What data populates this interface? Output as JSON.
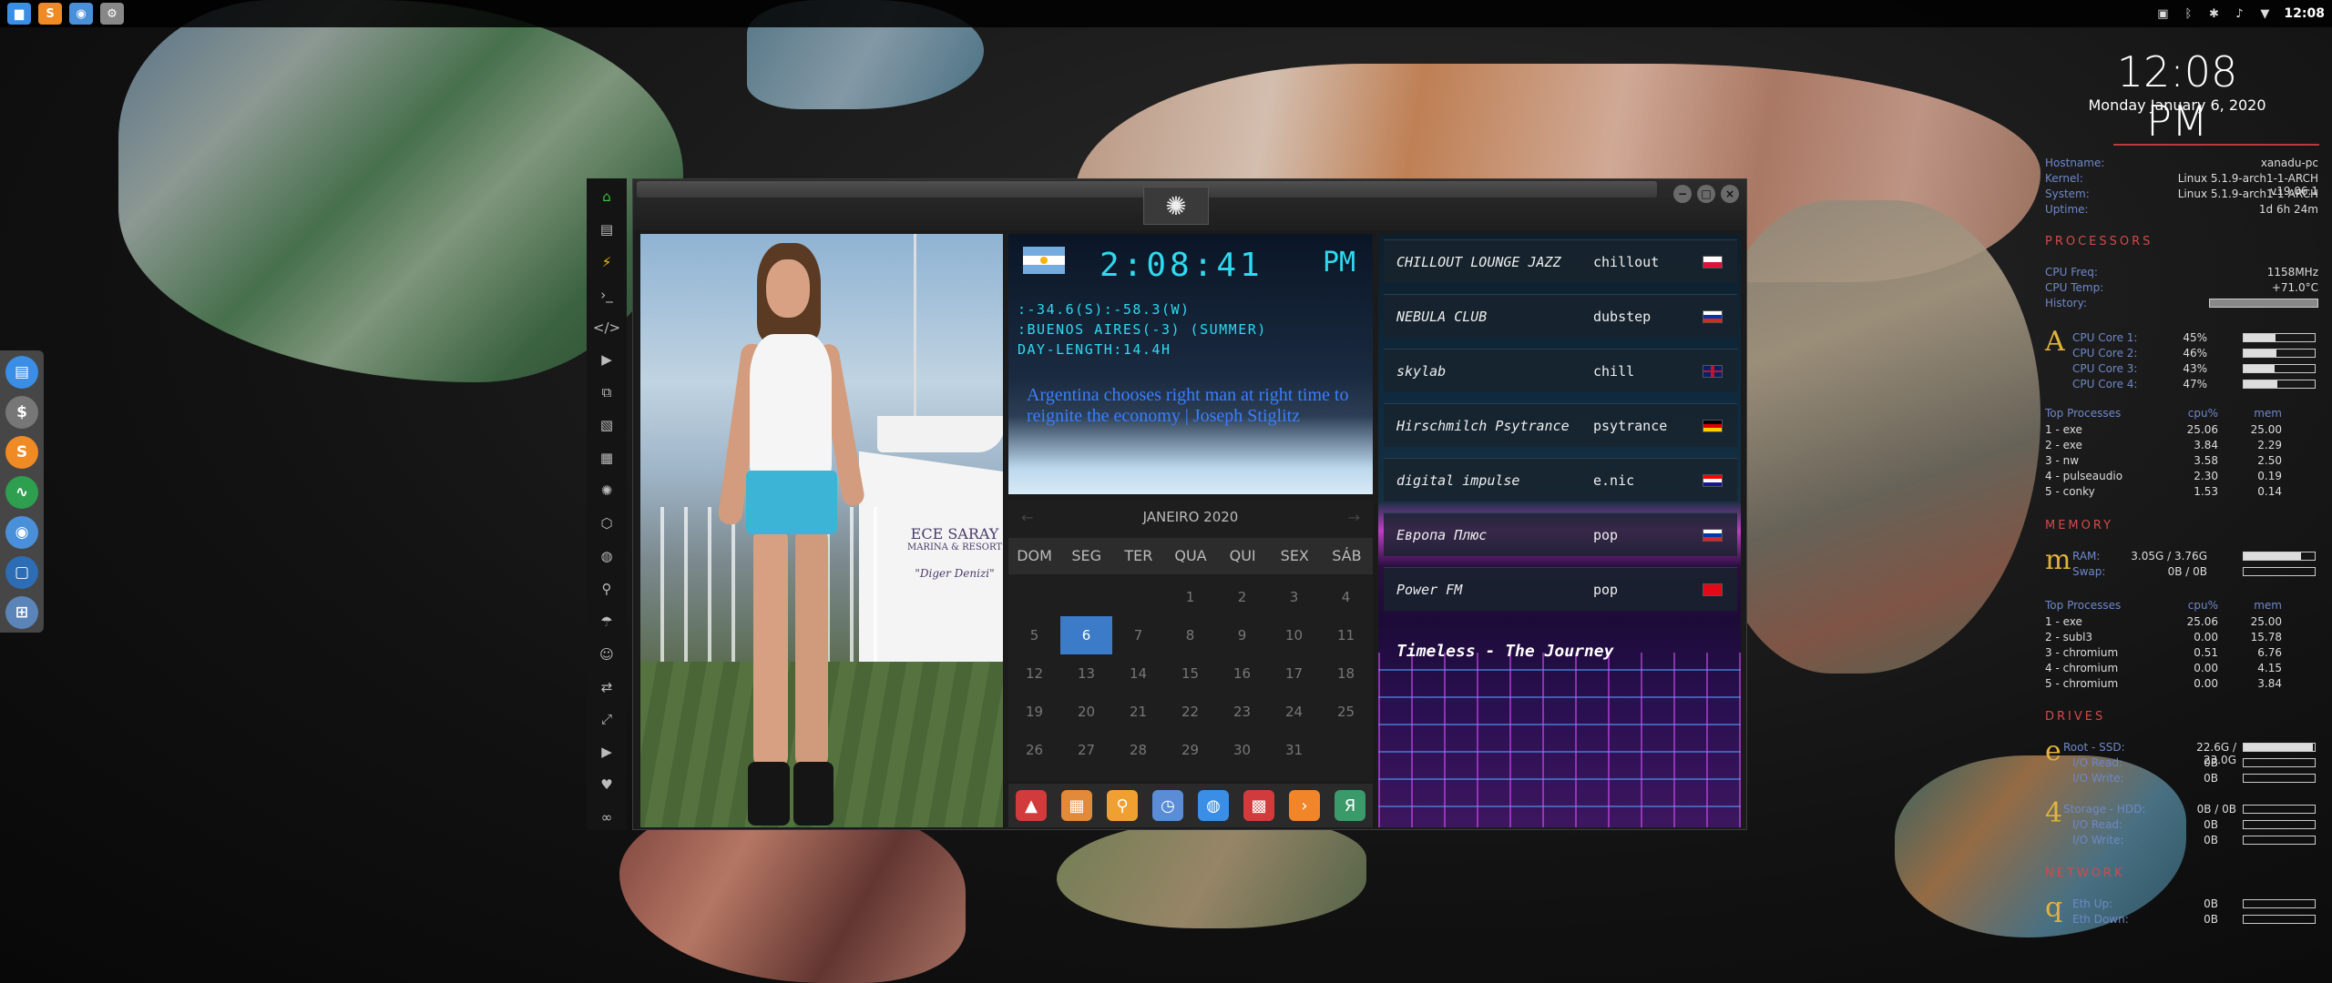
{
  "top_panel": {
    "launchers": [
      {
        "icon": "files-icon",
        "glyph": "▆",
        "color": "#3a8ee6"
      },
      {
        "icon": "sublime-icon",
        "glyph": "S",
        "color": "#f08a24"
      },
      {
        "icon": "chrome-icon",
        "glyph": "◉",
        "color": "#4a90d9"
      },
      {
        "icon": "settings-icon",
        "glyph": "⚙",
        "color": "#888888"
      }
    ],
    "tray": [
      {
        "icon": "screenshot-icon",
        "glyph": "▣"
      },
      {
        "icon": "bluetooth-icon",
        "glyph": "ᛒ"
      },
      {
        "icon": "security-alert-icon",
        "glyph": "✱"
      },
      {
        "icon": "volume-icon",
        "glyph": "♪"
      },
      {
        "icon": "wifi-icon",
        "glyph": "▼"
      }
    ],
    "clock": "12:08"
  },
  "left_dock": [
    {
      "icon": "files-icon",
      "glyph": "▤",
      "color": "#3a8ee6"
    },
    {
      "icon": "calc-icon",
      "glyph": "$",
      "color": "#777777"
    },
    {
      "icon": "sublime-icon",
      "glyph": "S",
      "color": "#f08a24"
    },
    {
      "icon": "activity-icon",
      "glyph": "∿",
      "color": "#2e9e4f"
    },
    {
      "icon": "chrome-icon",
      "glyph": "◉",
      "color": "#4a90d9"
    },
    {
      "icon": "screen-icon",
      "glyph": "▢",
      "color": "#2d6db5"
    },
    {
      "icon": "network-icon",
      "glyph": "⊞",
      "color": "#5b85b8"
    }
  ],
  "conky": {
    "time": "12:08 PM",
    "date": "Monday January  6, 2020",
    "hostname_label": "Hostname:",
    "hostname": "xanadu-pc",
    "kernel_label": "Kernel:",
    "kernel": "Linux 5.1.9-arch1-1-ARCH v19.06.1",
    "system_label": "System:",
    "system": "Linux 5.1.9-arch1-1-ARCH",
    "uptime_label": "Uptime:",
    "uptime": "1d 6h 24m",
    "processors_heading": "PROCESSORS",
    "cpu_freq_label": "CPU Freq:",
    "cpu_freq": "1158MHz",
    "cpu_temp_label": "CPU Temp:",
    "cpu_temp": "+71.0°C",
    "history_label": "History:",
    "cpu_letter": "A",
    "cores": [
      {
        "label": "CPU Core 1:",
        "value": "45%",
        "pct": 45
      },
      {
        "label": "CPU Core 2:",
        "value": "46%",
        "pct": 46
      },
      {
        "label": "CPU Core 3:",
        "value": "43%",
        "pct": 43
      },
      {
        "label": "CPU Core 4:",
        "value": "47%",
        "pct": 47
      }
    ],
    "top_processes_label": "Top Processes",
    "cpu_col": "cpu%",
    "mem_col": "mem",
    "cpu_processes": [
      {
        "name": "1 - exe",
        "cpu": "25.06",
        "mem": "25.00"
      },
      {
        "name": "2 - exe",
        "cpu": "3.84",
        "mem": "2.29"
      },
      {
        "name": "3 - nw",
        "cpu": "3.58",
        "mem": "2.50"
      },
      {
        "name": "4 - pulseaudio",
        "cpu": "2.30",
        "mem": "0.19"
      },
      {
        "name": "5 - conky",
        "cpu": "1.53",
        "mem": "0.14"
      }
    ],
    "memory_heading": "MEMORY",
    "mem_letter": "m",
    "ram_label": "RAM:",
    "ram": "3.05G / 3.76G",
    "ram_pct": 81,
    "swap_label": "Swap:",
    "swap": "0B / 0B",
    "mem_processes": [
      {
        "name": "1 - exe",
        "cpu": "25.06",
        "mem": "25.00"
      },
      {
        "name": "2 - subl3",
        "cpu": "0.00",
        "mem": "15.78"
      },
      {
        "name": "3 - chromium",
        "cpu": "0.51",
        "mem": "6.76"
      },
      {
        "name": "4 - chromium",
        "cpu": "0.00",
        "mem": "4.15"
      },
      {
        "name": "5 - chromium",
        "cpu": "0.00",
        "mem": "3.84"
      }
    ],
    "drives_heading": "DRIVES",
    "drive_letter_e": "e",
    "root_label": "Root - SSD:",
    "root": "22.6G / 23.0G",
    "root_pct": 98,
    "io_read_label": "I/O Read:",
    "io_read": "0B",
    "io_write_label": "I/O Write:",
    "io_write": "0B",
    "drive_letter_4": "4",
    "storage_label": "Storage - HDD:",
    "storage": "0B / 0B",
    "io_read2": "0B",
    "io_write2": "0B",
    "network_heading": "NETWORK",
    "net_letter": "q",
    "eth_up_label": "Eth Up:",
    "eth_up": "0B",
    "eth_down_label": "Eth Down:",
    "eth_down": "0B"
  },
  "side_icons": [
    {
      "icon": "home-icon",
      "glyph": "⌂",
      "color": "#3ec43e"
    },
    {
      "icon": "document-icon",
      "glyph": "▤",
      "color": "#bbbbbb"
    },
    {
      "icon": "flash-icon",
      "glyph": "⚡",
      "color": "#f2c200"
    },
    {
      "icon": "terminal-icon",
      "glyph": "›_",
      "color": "#bbbbbb"
    },
    {
      "icon": "code-icon",
      "glyph": "</>",
      "color": "#bbbbbb"
    },
    {
      "icon": "play-icon",
      "glyph": "▶",
      "color": "#bbbbbb"
    },
    {
      "icon": "copy-icon",
      "glyph": "⧉",
      "color": "#bbbbbb"
    },
    {
      "icon": "image-icon",
      "glyph": "▧",
      "color": "#bbbbbb"
    },
    {
      "icon": "card-icon",
      "glyph": "▦",
      "color": "#bbbbbb"
    },
    {
      "icon": "rebel-icon",
      "glyph": "✺",
      "color": "#bbbbbb"
    },
    {
      "icon": "hexagon-icon",
      "glyph": "⬡",
      "color": "#bbbbbb"
    },
    {
      "icon": "globe-icon",
      "glyph": "◍",
      "color": "#bbbbbb"
    },
    {
      "icon": "search-icon",
      "glyph": "⚲",
      "color": "#bbbbbb"
    },
    {
      "icon": "umbrella-icon",
      "glyph": "☂",
      "color": "#bbbbbb"
    },
    {
      "icon": "contact-icon",
      "glyph": "☺",
      "color": "#bbbbbb"
    },
    {
      "icon": "transfer-icon",
      "glyph": "⇄",
      "color": "#bbbbbb"
    },
    {
      "icon": "fullscreen-icon",
      "glyph": "⤢",
      "color": "#bbbbbb"
    },
    {
      "icon": "youtube-icon",
      "glyph": "▶",
      "color": "#bbbbbb"
    },
    {
      "icon": "heart-icon",
      "glyph": "♥",
      "color": "#bbbbbb"
    },
    {
      "icon": "link-icon",
      "glyph": "∞",
      "color": "#bbbbbb"
    }
  ],
  "window": {
    "minimize_icon": "−",
    "maximize_icon": "□",
    "close_icon": "×",
    "rebel_glyph": "✺"
  },
  "photo": {
    "logo_text": "ECE SARAY",
    "logo_sub": "MARINA & RESORT",
    "logo_script": "\"Diger Denizi\""
  },
  "world_clock": {
    "time": "2:08:41",
    "ampm": "PM",
    "coords": ":-34.6(S):-58.3(W)",
    "location": ":BUENOS AIRES(-3) (SUMMER)",
    "day_length": "DAY-LENGTH:14.4H",
    "headline": "Argentina chooses right man at right time to reignite the economy | Joseph Stiglitz"
  },
  "calendar": {
    "month": "JANEIRO 2020",
    "prev": "←",
    "next": "→",
    "dows": [
      "DOM",
      "SEG",
      "TER",
      "QUA",
      "QUI",
      "SEX",
      "SÁB"
    ],
    "weeks": [
      [
        "",
        "",
        "",
        "1",
        "2",
        "3",
        "4"
      ],
      [
        "5",
        "6",
        "7",
        "8",
        "9",
        "10",
        "11"
      ],
      [
        "12",
        "13",
        "14",
        "15",
        "16",
        "17",
        "18"
      ],
      [
        "19",
        "20",
        "21",
        "22",
        "23",
        "24",
        "25"
      ],
      [
        "26",
        "27",
        "28",
        "29",
        "30",
        "31",
        ""
      ]
    ],
    "today": "6"
  },
  "launcher_bar": [
    {
      "icon": "app-red-icon",
      "glyph": "▲",
      "color": "#d23b3b"
    },
    {
      "icon": "calendar-small-icon",
      "glyph": "▦",
      "color": "#e08a3a"
    },
    {
      "icon": "search-app-icon",
      "glyph": "⚲",
      "color": "#f0a030"
    },
    {
      "icon": "clock-app-icon",
      "glyph": "◷",
      "color": "#5a8dd6"
    },
    {
      "icon": "web-app-icon",
      "glyph": "◍",
      "color": "#3a8ee6"
    },
    {
      "icon": "calendar-app-icon",
      "glyph": "▩",
      "color": "#d23b3b"
    },
    {
      "icon": "arrow-app-icon",
      "glyph": "›",
      "color": "#f0852a"
    },
    {
      "icon": "yandex-app-icon",
      "glyph": "Я",
      "color": "#3a9a6a"
    }
  ],
  "radio": {
    "stations": [
      {
        "name": "CHILLOUT LOUNGE JAZZ",
        "genre": "chillout",
        "flag": "pl"
      },
      {
        "name": "NEBULA CLUB",
        "genre": "dubstep",
        "flag": "ru"
      },
      {
        "name": "skylab",
        "genre": "chill",
        "flag": "gb"
      },
      {
        "name": "Hirschmilch Psytrance",
        "genre": "psytrance",
        "flag": "de"
      },
      {
        "name": "digital impulse",
        "genre": "e.nic",
        "flag": "hr"
      },
      {
        "name": "Европа Плюс",
        "genre": "pop",
        "flag": "ru"
      },
      {
        "name": "Power FM",
        "genre": "pop",
        "flag": "tr"
      }
    ],
    "now_playing": "Timeless - The Journey"
  }
}
